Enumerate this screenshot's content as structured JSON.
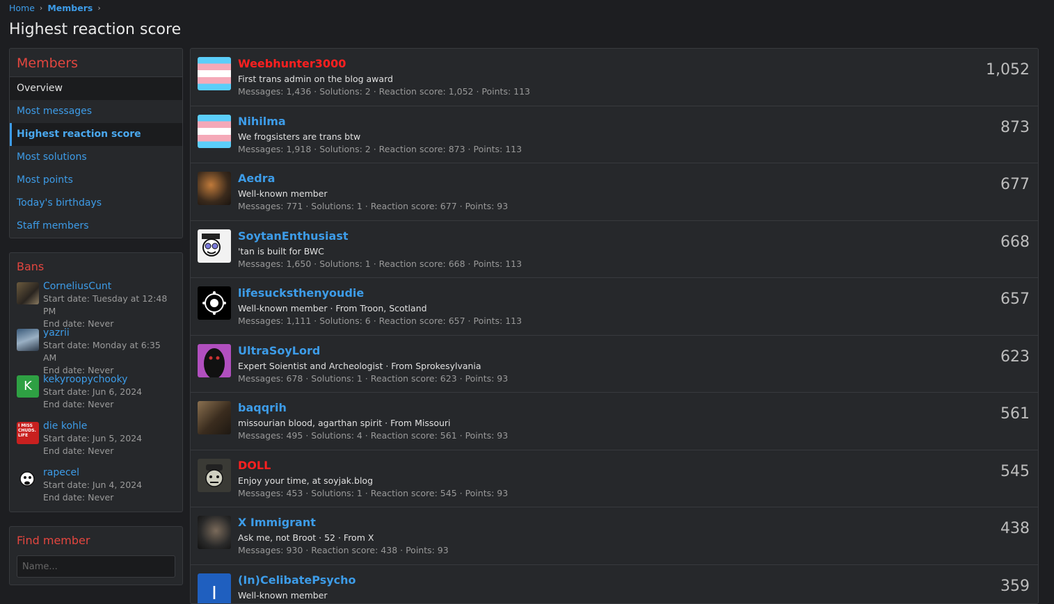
{
  "breadcrumb": {
    "home": "Home",
    "members": "Members",
    "sep": "›"
  },
  "page_title": "Highest reaction score",
  "sidebar": {
    "title": "Members",
    "items": [
      {
        "label": "Overview"
      },
      {
        "label": "Most messages"
      },
      {
        "label": "Highest reaction score"
      },
      {
        "label": "Most solutions"
      },
      {
        "label": "Most points"
      },
      {
        "label": "Today's birthdays"
      },
      {
        "label": "Staff members"
      }
    ]
  },
  "bans": {
    "title": "Bans",
    "items": [
      {
        "name": "CorneliusCunt",
        "start": "Start date: Tuesday at 12:48 PM",
        "end": "End date: Never"
      },
      {
        "name": "yazrii",
        "start": "Start date: Monday at 6:35 AM",
        "end": "End date: Never"
      },
      {
        "name": "kekyroopychooky",
        "letter": "K",
        "start": "Start date: Jun 6, 2024",
        "end": "End date: Never"
      },
      {
        "name": "die kohle",
        "avatar_text": "I MISS CHUDS. LIFE",
        "start": "Start date: Jun 5, 2024",
        "end": "End date: Never"
      },
      {
        "name": "rapecel",
        "start": "Start date: Jun 4, 2024",
        "end": "End date: Never"
      }
    ]
  },
  "find_member": {
    "title": "Find member",
    "placeholder": "Name..."
  },
  "members": [
    {
      "name": "Weebhunter3000",
      "color": "red",
      "title": "First trans admin on the blog award",
      "stats": "Messages: 1,436 · Solutions: 2 · Reaction score: 1,052 · Points: 113",
      "score": "1,052"
    },
    {
      "name": "Nihilma",
      "color": "blue",
      "title": "We frogsisters are trans btw",
      "stats": "Messages: 1,918 · Solutions: 2 · Reaction score: 873 · Points: 113",
      "score": "873"
    },
    {
      "name": "Aedra",
      "color": "blue",
      "title": "Well-known member",
      "stats": "Messages: 771 · Solutions: 1 · Reaction score: 677 · Points: 93",
      "score": "677"
    },
    {
      "name": "SoytanEnthusiast",
      "color": "blue",
      "title": "'tan is built for BWC",
      "stats": "Messages: 1,650 · Solutions: 1 · Reaction score: 668 · Points: 113",
      "score": "668"
    },
    {
      "name": "lifesucksthenyoudie",
      "color": "blue",
      "title": "Well-known member · From Troon, Scotland",
      "stats": "Messages: 1,111 · Solutions: 6 · Reaction score: 657 · Points: 113",
      "score": "657"
    },
    {
      "name": "UltraSoyLord",
      "color": "blue",
      "title": "Expert Soientist and Archeologist · From Sprokesylvania",
      "stats": "Messages: 678 · Solutions: 1 · Reaction score: 623 · Points: 93",
      "score": "623"
    },
    {
      "name": "baqqrih",
      "color": "blue",
      "title": "missourian blood, agarthan spirit · From Missouri",
      "stats": "Messages: 495 · Solutions: 4 · Reaction score: 561 · Points: 93",
      "score": "561"
    },
    {
      "name": "DOLL",
      "color": "red",
      "title": "Enjoy your time, at soyjak.blog",
      "stats": "Messages: 453 · Solutions: 1 · Reaction score: 545 · Points: 93",
      "score": "545"
    },
    {
      "name": "X Immigrant",
      "color": "blue",
      "title": "Ask me, not Broot · 52 · From X",
      "stats": "Messages: 930 · Reaction score: 438 · Points: 93",
      "score": "438"
    },
    {
      "name": "(In)CelibatePsycho",
      "color": "blue",
      "letter": "I",
      "title": "Well-known member",
      "stats": "",
      "score": "359"
    }
  ]
}
